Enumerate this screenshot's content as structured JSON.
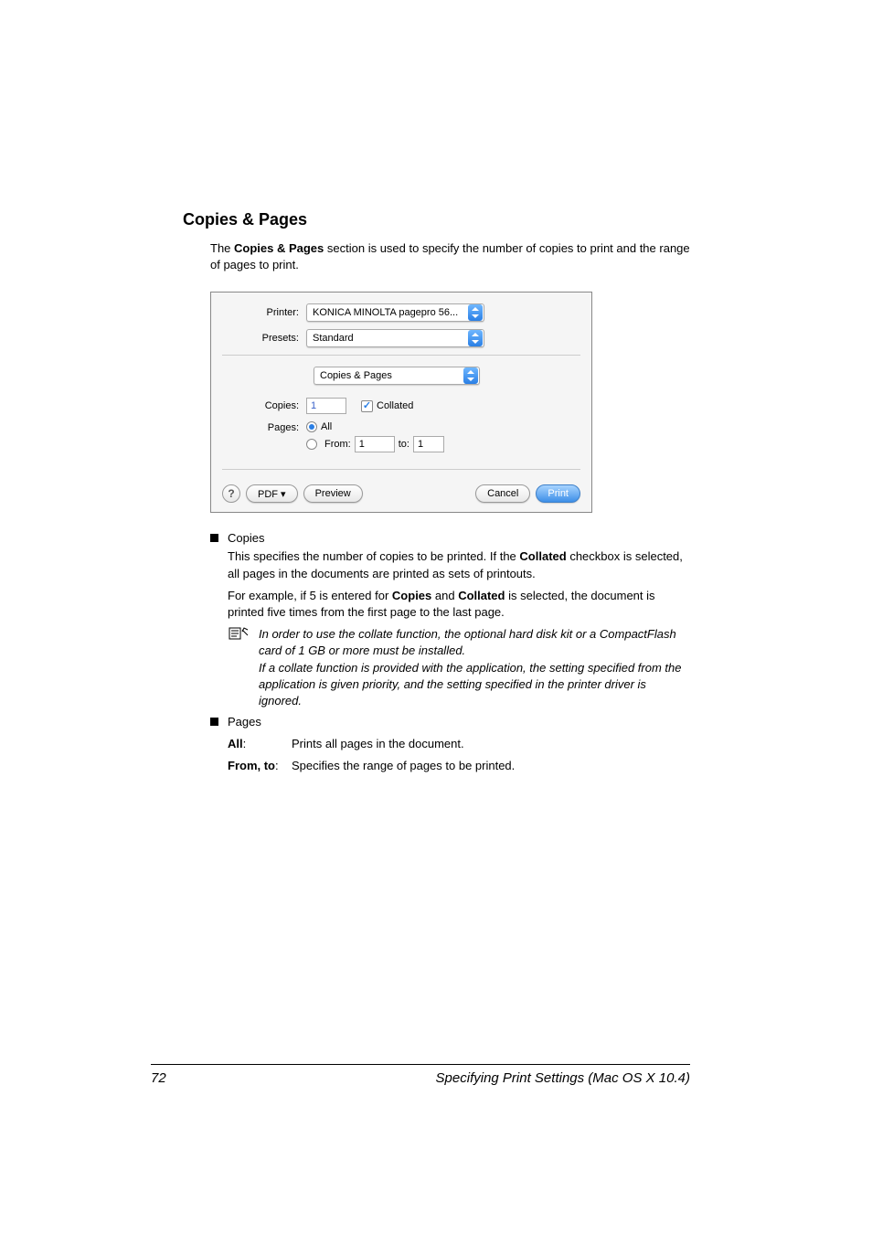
{
  "section_title": "Copies & Pages",
  "intro_1": "The ",
  "intro_bold": "Copies & Pages",
  "intro_2": " section is used to specify the number of copies to print and the range of pages to print.",
  "dialog": {
    "printer_label": "Printer:",
    "printer_value": "KONICA MINOLTA pagepro 56...",
    "presets_label": "Presets:",
    "presets_value": "Standard",
    "panel_value": "Copies & Pages",
    "copies_label": "Copies:",
    "copies_value": "1",
    "collated_label": "Collated",
    "pages_label": "Pages:",
    "all_label": "All",
    "from_label": "From:",
    "from_value": "1",
    "to_label": "to:",
    "to_value": "1",
    "pdf_label": "PDF ▾",
    "preview_label": "Preview",
    "cancel_label": "Cancel",
    "print_label": "Print"
  },
  "copies_title": "Copies",
  "copies_desc_1": "This specifies the number of copies to be printed. If the ",
  "copies_desc_bold": "Collated",
  "copies_desc_2": " checkbox is selected, all pages in the documents are printed as sets of printouts.",
  "copies_example_1": "For example, if 5 is entered for ",
  "copies_ex_bold1": "Copies",
  "copies_example_2": " and ",
  "copies_ex_bold2": "Collated",
  "copies_example_3": " is selected, the document is printed five times from the first page to the last page.",
  "note_1": "In order to use the collate function, the optional hard disk kit or a CompactFlash card of 1 GB or more must be installed.",
  "note_2": "If a collate function is provided with the application, the setting specified from the application is given priority, and the setting specified in the printer driver is ignored.",
  "pages_title": "Pages",
  "all_term": "All",
  "all_colon": ":",
  "all_def": "Prints all pages in the document.",
  "fromto_term": "From, to",
  "fromto_colon": ":",
  "fromto_def": "Specifies the range of pages to be printed.",
  "footer_page": "72",
  "footer_title": "Specifying Print Settings (Mac OS X 10.4)"
}
